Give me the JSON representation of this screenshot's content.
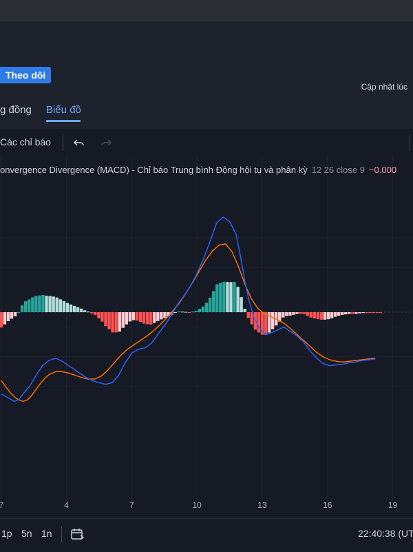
{
  "header": {
    "follow_label": "Theo dõi",
    "update_label": "Cập nhật lúc"
  },
  "tabs": [
    {
      "label": "g đồng",
      "active": false
    },
    {
      "label": "Biểu đồ",
      "active": true
    }
  ],
  "toolbar": {
    "indicators_label": "Các chỉ báo",
    "undo_icon": "undo-icon",
    "redo_icon": "redo-icon"
  },
  "legend": {
    "name": "onvergence Divergence (MACD) - Chỉ báo Trung bình Động hội tụ và phân kỳ",
    "params": "12 26 close 9",
    "value": "−0.000"
  },
  "bottom": {
    "ranges": [
      "1p",
      "5n",
      "1n"
    ],
    "calendar_icon": "calendar-icon",
    "time": "22:40:38 (UT"
  },
  "colors": {
    "macd_line": "#2962ff",
    "signal_line": "#ff6d00",
    "hist_up_strong": "#26a69a",
    "hist_up_weak": "#b2dfdb",
    "hist_down_strong": "#ff5252",
    "hist_down_weak": "#ffcdd2"
  },
  "chart_data": {
    "type": "line",
    "x_tick_labels": [
      "7",
      "4",
      "7",
      "10",
      "13",
      "16",
      "19"
    ],
    "x_tick_positions": [
      0,
      3,
      6,
      9,
      12,
      15,
      18
    ],
    "xlim": [
      0,
      18.5
    ],
    "ylim": [
      -1.35,
      1.35
    ],
    "series": [
      {
        "key": "macd",
        "x": [
          0,
          0.3,
          0.6,
          0.8,
          1.0,
          1.3,
          1.6,
          1.9,
          2.2,
          2.5,
          2.8,
          3.0,
          3.3,
          3.6,
          3.9,
          4.2,
          4.5,
          4.8,
          5.1,
          5.4,
          5.7,
          6.0,
          6.3,
          6.6,
          6.9,
          7.2,
          7.5,
          7.8,
          8.1,
          8.4,
          8.7,
          9.0,
          9.3,
          9.6,
          9.9,
          10.2,
          10.5,
          10.8,
          11.0,
          11.2,
          11.4,
          11.6,
          11.8,
          12.0,
          12.2,
          12.4,
          12.7,
          13.0,
          13.3,
          13.6,
          13.9,
          14.2,
          14.5,
          14.8,
          15.1,
          15.4,
          15.7,
          16.0,
          16.3,
          16.6,
          16.9,
          17.2
        ],
        "y": [
          -1.1,
          -1.15,
          -1.2,
          -1.18,
          -1.1,
          -1.0,
          -0.85,
          -0.72,
          -0.65,
          -0.62,
          -0.66,
          -0.7,
          -0.76,
          -0.82,
          -0.88,
          -0.92,
          -0.95,
          -0.97,
          -0.95,
          -0.85,
          -0.68,
          -0.55,
          -0.5,
          -0.48,
          -0.42,
          -0.3,
          -0.18,
          -0.05,
          0.1,
          0.22,
          0.35,
          0.52,
          0.72,
          0.95,
          1.2,
          1.28,
          1.22,
          1.05,
          0.75,
          0.42,
          0.15,
          -0.05,
          -0.18,
          -0.26,
          -0.3,
          -0.28,
          -0.24,
          -0.2,
          -0.26,
          -0.32,
          -0.4,
          -0.52,
          -0.62,
          -0.69,
          -0.72,
          -0.71,
          -0.7,
          -0.68,
          -0.67,
          -0.65,
          -0.64,
          -0.63
        ]
      },
      {
        "key": "signal",
        "x": [
          0,
          0.2,
          0.4,
          0.6,
          0.8,
          1.0,
          1.2,
          1.4,
          1.6,
          1.8,
          2.0,
          2.2,
          2.5,
          2.8,
          3.1,
          3.4,
          3.7,
          4.0,
          4.3,
          4.6,
          4.9,
          5.2,
          5.5,
          5.8,
          6.1,
          6.4,
          6.7,
          7.0,
          7.3,
          7.6,
          7.9,
          8.2,
          8.5,
          8.8,
          9.1,
          9.4,
          9.7,
          10.0,
          10.3,
          10.6,
          10.9,
          11.2,
          11.5,
          11.8,
          12.1,
          12.4,
          12.7,
          13.0,
          13.3,
          13.6,
          13.9,
          14.2,
          14.5,
          14.8,
          15.1,
          15.4,
          15.7,
          16.0,
          16.3,
          16.6,
          16.9,
          17.2
        ],
        "y": [
          -0.92,
          -1.0,
          -1.08,
          -1.14,
          -1.18,
          -1.2,
          -1.18,
          -1.12,
          -1.04,
          -0.96,
          -0.89,
          -0.84,
          -0.8,
          -0.8,
          -0.82,
          -0.85,
          -0.88,
          -0.9,
          -0.9,
          -0.86,
          -0.78,
          -0.68,
          -0.58,
          -0.5,
          -0.44,
          -0.38,
          -0.32,
          -0.25,
          -0.17,
          -0.08,
          0.02,
          0.13,
          0.26,
          0.4,
          0.55,
          0.7,
          0.82,
          0.9,
          0.92,
          0.82,
          0.62,
          0.38,
          0.18,
          0.05,
          -0.02,
          -0.06,
          -0.1,
          -0.15,
          -0.22,
          -0.3,
          -0.38,
          -0.46,
          -0.54,
          -0.6,
          -0.64,
          -0.66,
          -0.67,
          -0.66,
          -0.65,
          -0.64,
          -0.63,
          -0.62
        ]
      }
    ]
  }
}
